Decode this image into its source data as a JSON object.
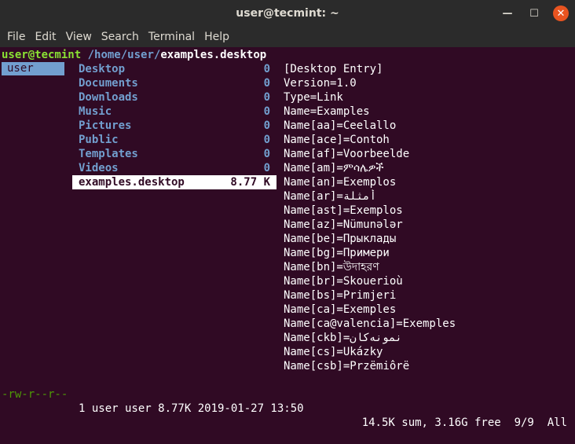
{
  "window": {
    "title": "user@tecmint: ~",
    "minimize_glyph": "—",
    "maximize_glyph": "☐",
    "close_glyph": "✕"
  },
  "menu": [
    "File",
    "Edit",
    "View",
    "Search",
    "Terminal",
    "Help"
  ],
  "path": {
    "user_host": "user@tecmint",
    "dir": " /home/user/",
    "file": "examples.desktop"
  },
  "parent_dir": "user",
  "files": [
    {
      "name": "Desktop",
      "size": "0",
      "type": "dir"
    },
    {
      "name": "Documents",
      "size": "0",
      "type": "dir"
    },
    {
      "name": "Downloads",
      "size": "0",
      "type": "dir"
    },
    {
      "name": "Music",
      "size": "0",
      "type": "dir"
    },
    {
      "name": "Pictures",
      "size": "0",
      "type": "dir"
    },
    {
      "name": "Public",
      "size": "0",
      "type": "dir"
    },
    {
      "name": "Templates",
      "size": "0",
      "type": "dir"
    },
    {
      "name": "Videos",
      "size": "0",
      "type": "dir"
    },
    {
      "name": "examples.desktop",
      "size": "8.77 K",
      "type": "file",
      "selected": true
    }
  ],
  "preview": [
    "[Desktop Entry]",
    "Version=1.0",
    "Type=Link",
    "Name=Examples",
    "Name[aa]=Ceelallo",
    "Name[ace]=Contoh",
    "Name[af]=Voorbeelde",
    "Name[am]=ምሳሌዎች",
    "Name[an]=Exemplos",
    "Name[ar]=أمثلة",
    "Name[ast]=Exemplos",
    "Name[az]=Nümunələr",
    "Name[be]=Прыклады",
    "Name[bg]=Примери",
    "Name[bn]=উদাহরণ",
    "Name[br]=Skouerioù",
    "Name[bs]=Primjeri",
    "Name[ca]=Exemples",
    "Name[ca@valencia]=Exemples",
    "Name[ckb]=نمونەکان",
    "Name[cs]=Ukázky",
    "Name[csb]=Przëmiôrë"
  ],
  "status": {
    "permissions": "-rw-r--r--",
    "meta": "1 user user 8.77K 2019-01-27 13:50",
    "right": "14.5K sum, 3.16G free  9/9  All"
  },
  "colors": {
    "background": "#300a24",
    "dir": "#729fcf",
    "user_host": "#8ae234",
    "permissions": "#4e9a06",
    "close_button": "#e95420"
  }
}
